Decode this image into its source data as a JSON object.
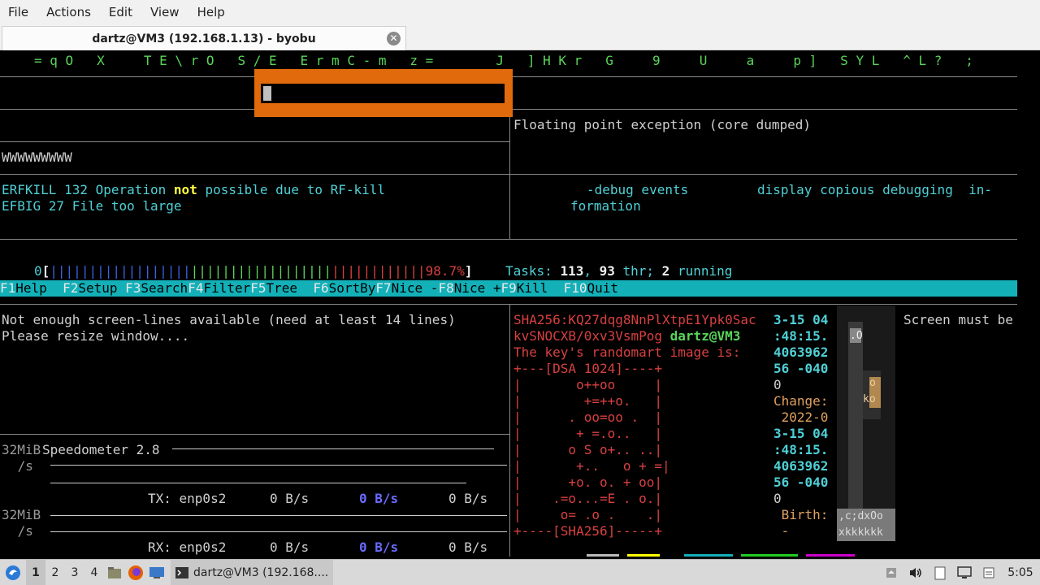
{
  "menubar": {
    "items": [
      "File",
      "Actions",
      "Edit",
      "View",
      "Help"
    ]
  },
  "tab": {
    "title": "dartz@VM3 (192.168.1.13) - byobu"
  },
  "terminal": {
    "top_line": "= q O   X     T E \\ r O   S / E   E r m C - m   z =        J   ] H K r   G     9     U     a     p ]   S Y L   ^ L ?   ;",
    "fpe": "Floating point exception (core dumped)",
    "wwww": "WWWWWWWWW",
    "erfkill_code": "ERFKILL 132 ",
    "erfkill_a": "Operation ",
    "erfkill_not": "not",
    "erfkill_b": " possible due to RF-kill",
    "efbig_code": "EFBIG 27 ",
    "efbig_msg": "File too large",
    "debug_opt": "-debug events",
    "debug_desc": "display copious debugging  in-",
    "debug_desc2": "formation",
    "htop": {
      "cpu_label": "0",
      "bar_blue": "||||||||||||||||||",
      "bar_green": "||||||||||||||||||",
      "bar_red": "||||||||||||",
      "percent": "98.7%",
      "tasks_label": "Tasks: ",
      "tasks": "113",
      "thr_sep": ", ",
      "thr": "93",
      "thr_label": " thr; ",
      "running": "2",
      "running_label": " running"
    },
    "fkeys": [
      {
        "key": "F1",
        "label": "Help  "
      },
      {
        "key": "F2",
        "label": "Setup "
      },
      {
        "key": "F3",
        "label": "Search"
      },
      {
        "key": "F4",
        "label": "Filter"
      },
      {
        "key": "F5",
        "label": "Tree  "
      },
      {
        "key": "F6",
        "label": "SortBy"
      },
      {
        "key": "F7",
        "label": "Nice -"
      },
      {
        "key": "F8",
        "label": "Nice +"
      },
      {
        "key": "F9",
        "label": "Kill  "
      },
      {
        "key": "F10",
        "label": "Quit"
      }
    ],
    "not_enough_1": "Not enough screen-lines available (need at least 14 lines)",
    "not_enough_2": "Please resize window....",
    "speedometer": "Speedometer 2.8",
    "mib1": "32MiB",
    "per_s1": " /s",
    "tx_label": "TX: enp0s2",
    "tx_v1": "0 B/s",
    "tx_v2": "0 B/s",
    "tx_v3": "0 B/s",
    "mib2": "32MiB",
    "per_s2": " /s",
    "rx_label": "RX: enp0s2",
    "rx_v1": "0 B/s",
    "rx_v2": "0 B/s",
    "rx_v3": "0 B/s",
    "sha_1": "SHA256:KQ27dqg8NnPlXtpE1Ypk0Sac",
    "sha_2": "kvSNOCXB/0xv3VsmPog ",
    "sha_user": "dartz@VM3",
    "randomart_title": "The key's randomart image is:",
    "randomart": [
      "+---[DSA 1024]----+",
      "|       o++oo     |",
      "|        +=++o.   |",
      "|      . oo=oo .  |",
      "|       + =.o..   |",
      "|      o S o+.. ..|",
      "|       +..   o + =|",
      "|      +o. o. + oo|",
      "|    .=o...=E . o.|",
      "|     o= .o .    .|",
      "+----[SHA256]-----+"
    ],
    "stat": [
      "3-15 04",
      ":48:15.",
      "4063962",
      "56 -040",
      "0",
      "Change:",
      " 2022-0",
      "3-15 04",
      ":48:15.",
      "4063962",
      "56 -040",
      "0",
      " Birth:",
      " -"
    ],
    "screen_must": "Screen must be",
    "art_chars": [
      ".O",
      "o",
      "ko",
      ",c;dxOo",
      "xkkkkkk"
    ]
  },
  "taskbar": {
    "workspaces": [
      "1",
      "2",
      "3",
      "4"
    ],
    "window_title": "dartz@VM3 (192.168....",
    "clock": "5:05"
  }
}
